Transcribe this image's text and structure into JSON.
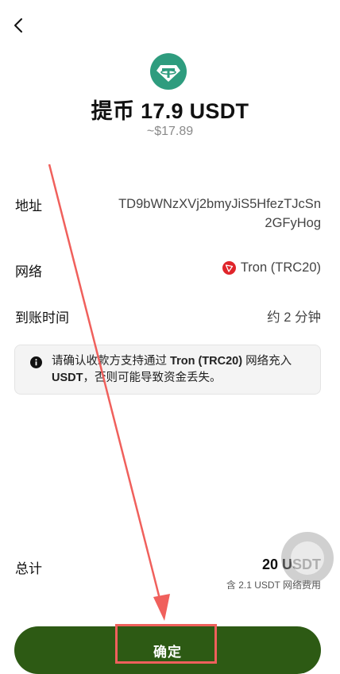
{
  "header": {
    "title": "提币 17.9 USDT",
    "subtitle": "~$17.89"
  },
  "details": {
    "address_label": "地址",
    "address_value_line1": "TD9bWNzXVj2bmyJiS5HfezTJcSn",
    "address_value_line2": "2GFyHog",
    "network_label": "网络",
    "network_value": "Tron (TRC20)",
    "arrival_label": "到账时间",
    "arrival_value": "约 2 分钟"
  },
  "notice": {
    "text_1": "请确认收款方支持通过 ",
    "bold_1": "Tron (TRC20)",
    "text_2": " 网络充入 ",
    "bold_2": "USDT",
    "text_3": "，否则可能导致资金丢失。"
  },
  "total": {
    "label": "总计",
    "value": "20 USDT",
    "fee": "含 2.1 USDT 网络费用"
  },
  "confirm_button": {
    "label": "确定"
  },
  "colors": {
    "accent": "#2d5a14",
    "coin": "#2e9c7e",
    "tron": "#e0252b",
    "annotation": "#f0605c"
  }
}
